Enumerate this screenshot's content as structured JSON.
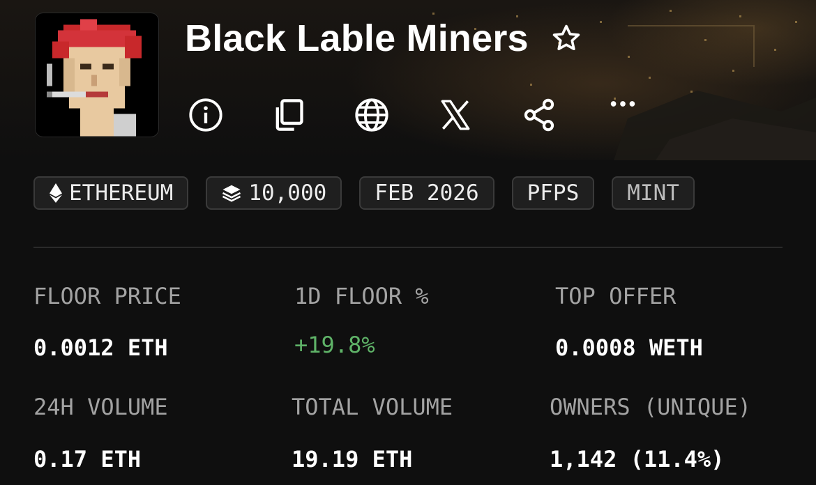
{
  "collection": {
    "title": "Black Lable Miners",
    "favorite_icon": "star-outline-icon",
    "avatar_description_icon": "pixel-miner-avatar"
  },
  "actions": [
    {
      "id": "info",
      "icon": "info-icon"
    },
    {
      "id": "copy",
      "icon": "copy-icon"
    },
    {
      "id": "website",
      "icon": "globe-icon"
    },
    {
      "id": "x",
      "icon": "x-logo-icon"
    },
    {
      "id": "share",
      "icon": "share-icon"
    },
    {
      "id": "more",
      "icon": "more-horizontal-icon"
    }
  ],
  "chips": {
    "chain": {
      "icon": "ethereum-icon",
      "label": "ETHEREUM"
    },
    "supply": {
      "icon": "layers-icon",
      "label": "10,000"
    },
    "date": {
      "label": "FEB 2026"
    },
    "category": {
      "label": "PFPS"
    },
    "mint": {
      "label": "MINT"
    }
  },
  "stats": {
    "floor_price": {
      "label": "FLOOR PRICE",
      "value": "0.0012 ETH"
    },
    "floor_change_1d": {
      "label": "1D FLOOR %",
      "value": "+19.8%"
    },
    "top_offer": {
      "label": "TOP OFFER",
      "value": "0.0008 WETH"
    },
    "volume_24h": {
      "label": "24H VOLUME",
      "value": "0.17 ETH"
    },
    "total_volume": {
      "label": "TOTAL VOLUME",
      "value": "19.19 ETH"
    },
    "owners": {
      "label": "OWNERS (UNIQUE)",
      "value": "1,142 (11.4%)"
    }
  },
  "colors": {
    "background": "#0f0f0f",
    "chip_bg": "#1f1f1f",
    "chip_border": "#3a3a3a",
    "label": "#a3a3a3",
    "positive": "#5fb368"
  }
}
